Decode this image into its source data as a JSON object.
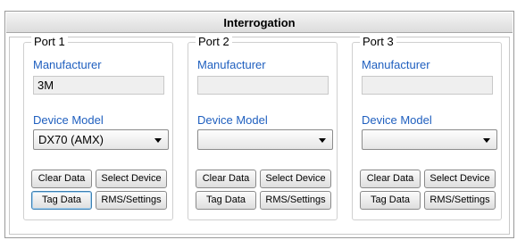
{
  "panel": {
    "title": "Interrogation"
  },
  "ports": [
    {
      "name": "Port 1",
      "manufacturer_label": "Manufacturer",
      "manufacturer_value": "3M",
      "model_label": "Device Model",
      "model_value": "DX70 (AMX)",
      "buttons": {
        "clear": "Clear Data",
        "select": "Select Device",
        "tag": "Tag Data",
        "rms": "RMS/Settings"
      }
    },
    {
      "name": "Port 2",
      "manufacturer_label": "Manufacturer",
      "manufacturer_value": "",
      "model_label": "Device Model",
      "model_value": "",
      "buttons": {
        "clear": "Clear Data",
        "select": "Select Device",
        "tag": "Tag Data",
        "rms": "RMS/Settings"
      }
    },
    {
      "name": "Port 3",
      "manufacturer_label": "Manufacturer",
      "manufacturer_value": "",
      "model_label": "Device Model",
      "model_value": "",
      "buttons": {
        "clear": "Clear Data",
        "select": "Select Device",
        "tag": "Tag Data",
        "rms": "RMS/Settings"
      }
    }
  ],
  "colors": {
    "label_blue": "#1f5fbf",
    "field_gray": "#efefef",
    "focus_blue": "#3c7fb1"
  },
  "icons": {
    "dropdown": "chevron-down-icon"
  }
}
